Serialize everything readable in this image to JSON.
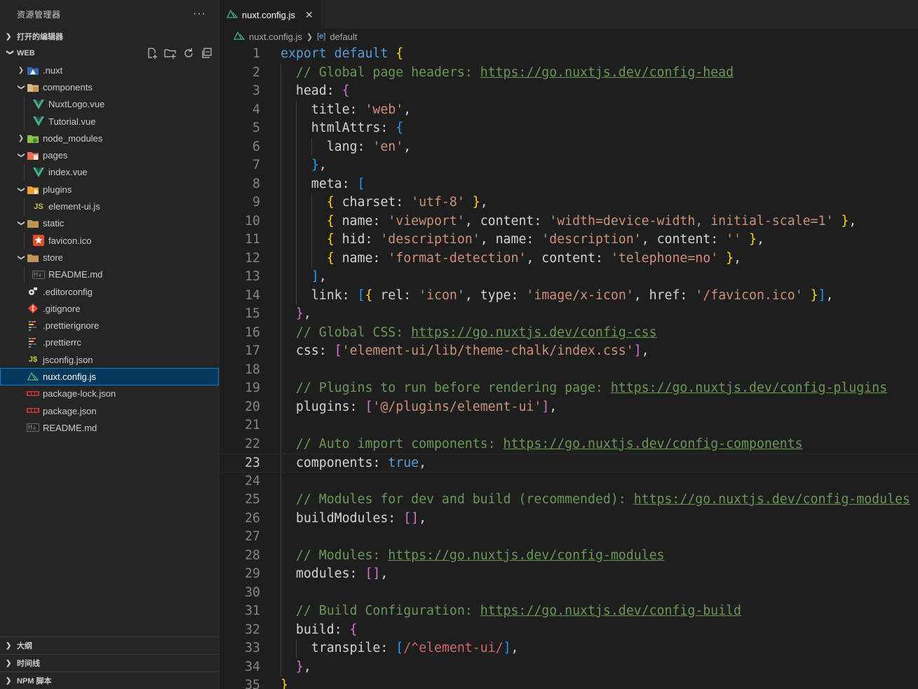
{
  "sidebar": {
    "title": "资源管理器",
    "more_label": "···",
    "open_editors_label": "打开的编辑器",
    "workspace_label": "WEB",
    "tree": [
      {
        "label": ".nuxt",
        "depth": 1,
        "chevron": ">",
        "icon": "nuxt-folder-icon"
      },
      {
        "label": "components",
        "depth": 1,
        "chevron": "v",
        "icon": "components-folder-icon"
      },
      {
        "label": "NuxtLogo.vue",
        "depth": 2,
        "chevron": "",
        "icon": "vue-file-icon"
      },
      {
        "label": "Tutorial.vue",
        "depth": 2,
        "chevron": "",
        "icon": "vue-file-icon"
      },
      {
        "label": "node_modules",
        "depth": 1,
        "chevron": ">",
        "icon": "node-folder-icon"
      },
      {
        "label": "pages",
        "depth": 1,
        "chevron": "v",
        "icon": "pages-folder-icon"
      },
      {
        "label": "index.vue",
        "depth": 2,
        "chevron": "",
        "icon": "vue-file-icon"
      },
      {
        "label": "plugins",
        "depth": 1,
        "chevron": "v",
        "icon": "plugins-folder-icon"
      },
      {
        "label": "element-ui.js",
        "depth": 2,
        "chevron": "",
        "icon": "js-file-icon"
      },
      {
        "label": "static",
        "depth": 1,
        "chevron": "v",
        "icon": "folder-icon"
      },
      {
        "label": "favicon.ico",
        "depth": 2,
        "chevron": "",
        "icon": "favicon-file-icon"
      },
      {
        "label": "store",
        "depth": 1,
        "chevron": "v",
        "icon": "folder-icon"
      },
      {
        "label": "README.md",
        "depth": 2,
        "chevron": "",
        "icon": "markdown-file-icon"
      },
      {
        "label": ".editorconfig",
        "depth": 1,
        "chevron": "",
        "icon": "editorconfig-file-icon"
      },
      {
        "label": ".gitignore",
        "depth": 1,
        "chevron": "",
        "icon": "git-file-icon"
      },
      {
        "label": ".prettierignore",
        "depth": 1,
        "chevron": "",
        "icon": "prettier-file-icon"
      },
      {
        "label": ".prettierrc",
        "depth": 1,
        "chevron": "",
        "icon": "prettier-file-icon"
      },
      {
        "label": "jsconfig.json",
        "depth": 1,
        "chevron": "",
        "icon": "jsconfig-file-icon"
      },
      {
        "label": "nuxt.config.js",
        "depth": 1,
        "chevron": "",
        "icon": "nuxt-file-icon",
        "selected": true
      },
      {
        "label": "package-lock.json",
        "depth": 1,
        "chevron": "",
        "icon": "npm-file-icon"
      },
      {
        "label": "package.json",
        "depth": 1,
        "chevron": "",
        "icon": "npm-file-icon"
      },
      {
        "label": "README.md",
        "depth": 1,
        "chevron": "",
        "icon": "markdown-file-icon"
      }
    ],
    "bottom_sections": [
      "大纲",
      "时间线",
      "NPM 脚本"
    ]
  },
  "editor": {
    "tab_label": "nuxt.config.js",
    "tab_close": "✕",
    "breadcrumb": {
      "file": "nuxt.config.js",
      "symbol": "default"
    },
    "current_line": 23,
    "lines": [
      {
        "n": "1",
        "indent": 0,
        "tokens": [
          [
            "kw",
            "export "
          ],
          [
            "kw",
            "default "
          ],
          [
            "b1",
            "{"
          ]
        ]
      },
      {
        "n": "2",
        "indent": 1,
        "tokens": [
          [
            "cm",
            "// Global page headers: "
          ],
          [
            "url",
            "https://go.nuxtjs.dev/config-head"
          ]
        ]
      },
      {
        "n": "3",
        "indent": 1,
        "tokens": [
          [
            "pl",
            "head: "
          ],
          [
            "b2",
            "{"
          ]
        ]
      },
      {
        "n": "4",
        "indent": 2,
        "tokens": [
          [
            "pl",
            "title: "
          ],
          [
            "str",
            "'web'"
          ],
          [
            "pl",
            ","
          ]
        ]
      },
      {
        "n": "5",
        "indent": 2,
        "tokens": [
          [
            "pl",
            "htmlAttrs: "
          ],
          [
            "b3",
            "{"
          ]
        ]
      },
      {
        "n": "6",
        "indent": 3,
        "tokens": [
          [
            "pl",
            "lang: "
          ],
          [
            "str",
            "'en'"
          ],
          [
            "pl",
            ","
          ]
        ]
      },
      {
        "n": "7",
        "indent": 2,
        "tokens": [
          [
            "b3",
            "}"
          ],
          [
            "pl",
            ","
          ]
        ]
      },
      {
        "n": "8",
        "indent": 2,
        "tokens": [
          [
            "pl",
            "meta: "
          ],
          [
            "b3",
            "["
          ]
        ]
      },
      {
        "n": "9",
        "indent": 3,
        "tokens": [
          [
            "b1",
            "{ "
          ],
          [
            "pl",
            "charset: "
          ],
          [
            "str",
            "'utf-8'"
          ],
          [
            "b1",
            " }"
          ],
          [
            "pl",
            ","
          ]
        ]
      },
      {
        "n": "10",
        "indent": 3,
        "tokens": [
          [
            "b1",
            "{ "
          ],
          [
            "pl",
            "name: "
          ],
          [
            "str",
            "'viewport'"
          ],
          [
            "pl",
            ", content: "
          ],
          [
            "str",
            "'width=device-width, initial-scale=1'"
          ],
          [
            "b1",
            " }"
          ],
          [
            "pl",
            ","
          ]
        ]
      },
      {
        "n": "11",
        "indent": 3,
        "tokens": [
          [
            "b1",
            "{ "
          ],
          [
            "pl",
            "hid: "
          ],
          [
            "str",
            "'description'"
          ],
          [
            "pl",
            ", name: "
          ],
          [
            "str",
            "'description'"
          ],
          [
            "pl",
            ", content: "
          ],
          [
            "str",
            "''"
          ],
          [
            "b1",
            " }"
          ],
          [
            "pl",
            ","
          ]
        ]
      },
      {
        "n": "12",
        "indent": 3,
        "tokens": [
          [
            "b1",
            "{ "
          ],
          [
            "pl",
            "name: "
          ],
          [
            "str",
            "'format-detection'"
          ],
          [
            "pl",
            ", content: "
          ],
          [
            "str",
            "'telephone=no'"
          ],
          [
            "b1",
            " }"
          ],
          [
            "pl",
            ","
          ]
        ]
      },
      {
        "n": "13",
        "indent": 2,
        "tokens": [
          [
            "b3",
            "]"
          ],
          [
            "pl",
            ","
          ]
        ]
      },
      {
        "n": "14",
        "indent": 2,
        "tokens": [
          [
            "pl",
            "link: "
          ],
          [
            "b3",
            "["
          ],
          [
            "b1",
            "{ "
          ],
          [
            "pl",
            "rel: "
          ],
          [
            "str",
            "'icon'"
          ],
          [
            "pl",
            ", type: "
          ],
          [
            "str",
            "'image/x-icon'"
          ],
          [
            "pl",
            ", href: "
          ],
          [
            "str",
            "'/favicon.ico'"
          ],
          [
            "b1",
            " }"
          ],
          [
            "b3",
            "]"
          ],
          [
            "pl",
            ","
          ]
        ]
      },
      {
        "n": "15",
        "indent": 1,
        "tokens": [
          [
            "b2",
            "}"
          ],
          [
            "pl",
            ","
          ]
        ]
      },
      {
        "n": "16",
        "indent": 1,
        "tokens": [
          [
            "cm",
            "// Global CSS: "
          ],
          [
            "url",
            "https://go.nuxtjs.dev/config-css"
          ]
        ]
      },
      {
        "n": "17",
        "indent": 1,
        "tokens": [
          [
            "pl",
            "css: "
          ],
          [
            "b2",
            "["
          ],
          [
            "str",
            "'element-ui/lib/theme-chalk/index.css'"
          ],
          [
            "b2",
            "]"
          ],
          [
            "pl",
            ","
          ]
        ]
      },
      {
        "n": "18",
        "indent": 1,
        "tokens": []
      },
      {
        "n": "19",
        "indent": 1,
        "tokens": [
          [
            "cm",
            "// Plugins to run before rendering page: "
          ],
          [
            "url",
            "https://go.nuxtjs.dev/config-plugins"
          ]
        ]
      },
      {
        "n": "20",
        "indent": 1,
        "tokens": [
          [
            "pl",
            "plugins: "
          ],
          [
            "b2",
            "["
          ],
          [
            "str",
            "'@/plugins/element-ui'"
          ],
          [
            "b2",
            "]"
          ],
          [
            "pl",
            ","
          ]
        ]
      },
      {
        "n": "21",
        "indent": 1,
        "tokens": []
      },
      {
        "n": "22",
        "indent": 1,
        "tokens": [
          [
            "cm",
            "// Auto import components: "
          ],
          [
            "url",
            "https://go.nuxtjs.dev/config-components"
          ]
        ]
      },
      {
        "n": "23",
        "indent": 1,
        "tokens": [
          [
            "pl",
            "components: "
          ],
          [
            "kw",
            "true"
          ],
          [
            "pl",
            ","
          ]
        ]
      },
      {
        "n": "24",
        "indent": 1,
        "tokens": []
      },
      {
        "n": "25",
        "indent": 1,
        "tokens": [
          [
            "cm",
            "// Modules for dev and build (recommended): "
          ],
          [
            "url",
            "https://go.nuxtjs.dev/config-modules"
          ]
        ]
      },
      {
        "n": "26",
        "indent": 1,
        "tokens": [
          [
            "pl",
            "buildModules: "
          ],
          [
            "b2",
            "[]"
          ],
          [
            "pl",
            ","
          ]
        ]
      },
      {
        "n": "27",
        "indent": 1,
        "tokens": []
      },
      {
        "n": "28",
        "indent": 1,
        "tokens": [
          [
            "cm",
            "// Modules: "
          ],
          [
            "url",
            "https://go.nuxtjs.dev/config-modules"
          ]
        ]
      },
      {
        "n": "29",
        "indent": 1,
        "tokens": [
          [
            "pl",
            "modules: "
          ],
          [
            "b2",
            "[]"
          ],
          [
            "pl",
            ","
          ]
        ]
      },
      {
        "n": "30",
        "indent": 1,
        "tokens": []
      },
      {
        "n": "31",
        "indent": 1,
        "tokens": [
          [
            "cm",
            "// Build Configuration: "
          ],
          [
            "url",
            "https://go.nuxtjs.dev/config-build"
          ]
        ]
      },
      {
        "n": "32",
        "indent": 1,
        "tokens": [
          [
            "pl",
            "build: "
          ],
          [
            "b2",
            "{"
          ]
        ]
      },
      {
        "n": "33",
        "indent": 2,
        "tokens": [
          [
            "pl",
            "transpile: "
          ],
          [
            "b3",
            "["
          ],
          [
            "rx",
            "/^element-ui/"
          ],
          [
            "b3",
            "]"
          ],
          [
            "pl",
            ","
          ]
        ]
      },
      {
        "n": "34",
        "indent": 1,
        "tokens": [
          [
            "b2",
            "}"
          ],
          [
            "pl",
            ","
          ]
        ]
      },
      {
        "n": "35",
        "indent": 0,
        "tokens": [
          [
            "b1",
            "}"
          ]
        ]
      }
    ]
  },
  "colors": {
    "editor_bg": "#1e1e1e",
    "sidebar_bg": "#252526",
    "selection": "#04395e",
    "focus_border": "#007fd4"
  }
}
